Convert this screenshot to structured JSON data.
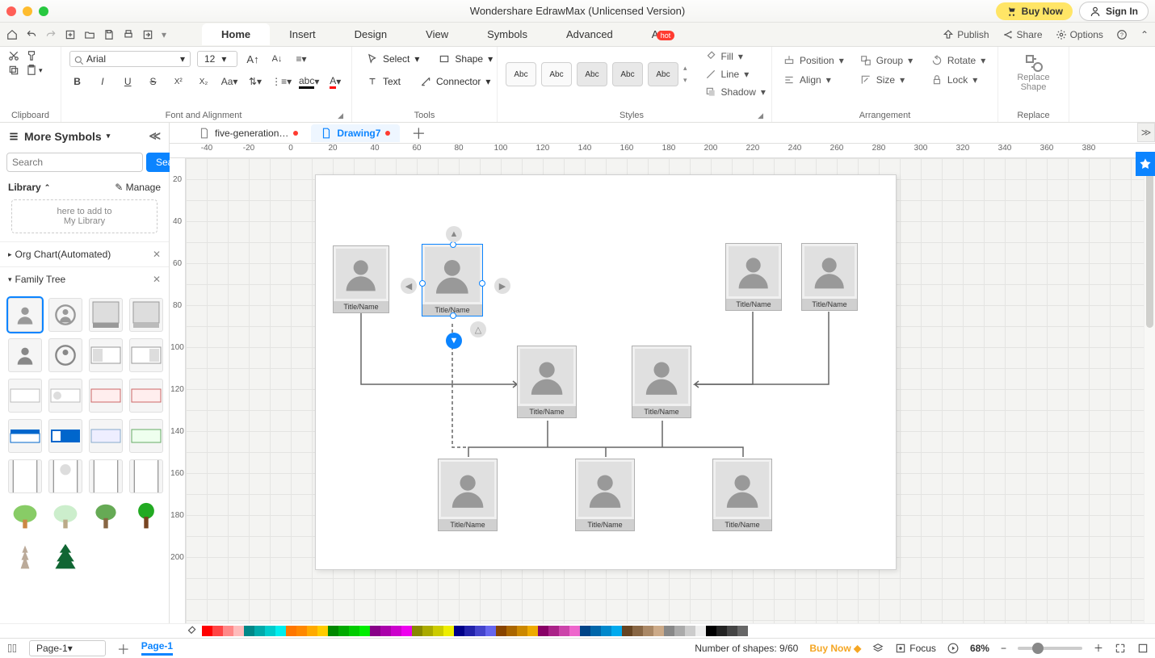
{
  "titlebar": {
    "title": "Wondershare EdrawMax (Unlicensed Version)",
    "buy": "Buy Now",
    "signin": "Sign In"
  },
  "menubar": {
    "tabs": [
      "Home",
      "Insert",
      "Design",
      "View",
      "Symbols",
      "Advanced",
      "AI"
    ],
    "active": 0,
    "hot": "hot",
    "right": {
      "publish": "Publish",
      "share": "Share",
      "options": "Options"
    }
  },
  "ribbon": {
    "font": {
      "name": "Arial",
      "size": "12"
    },
    "groups": {
      "clipboard": "Clipboard",
      "font": "Font and Alignment",
      "tools": "Tools",
      "styles": "Styles",
      "arrange": "Arrangement",
      "replace": "Replace"
    },
    "tools": {
      "select": "Select",
      "shape": "Shape",
      "text": "Text",
      "connector": "Connector"
    },
    "style_label": "Abc",
    "fill": "Fill",
    "line": "Line",
    "shadow": "Shadow",
    "position": "Position",
    "group": "Group",
    "rotate": "Rotate",
    "align": "Align",
    "size": "Size",
    "lock": "Lock",
    "replace_shape": "Replace\nShape"
  },
  "sidebar": {
    "title": "More Symbols",
    "search_placeholder": "Search",
    "search_btn": "Search",
    "library": "Library",
    "manage": "Manage",
    "drop_hint": "here to add to\nMy Library",
    "sections": [
      "Org Chart(Automated)",
      "Family Tree"
    ]
  },
  "filetabs": [
    {
      "label": "five-generation…",
      "active": false,
      "dirty": true
    },
    {
      "label": "Drawing7",
      "active": true,
      "dirty": true
    }
  ],
  "ruler_h": [
    "-40",
    "-20",
    "0",
    "20",
    "40",
    "60",
    "80",
    "100",
    "120",
    "140",
    "160",
    "180",
    "200",
    "220",
    "240",
    "260",
    "280",
    "300",
    "320",
    "340",
    "360",
    "380"
  ],
  "ruler_v": [
    "20",
    "40",
    "60",
    "80",
    "100",
    "120",
    "140",
    "160",
    "180",
    "200"
  ],
  "card_label": "Title/Name",
  "statusbar": {
    "page": "Page-1",
    "page_name": "Page-1",
    "shapes": "Number of shapes: 9/60",
    "buy": "Buy Now",
    "focus": "Focus",
    "zoom": "68%"
  },
  "colors": [
    "#f00",
    "#f44",
    "#f88",
    "#fbb",
    "#088",
    "#0aa",
    "#0cc",
    "#0ee",
    "#f70",
    "#f80",
    "#fa0",
    "#fc0",
    "#080",
    "#0a0",
    "#0c0",
    "#0e0",
    "#808",
    "#a0a",
    "#c0c",
    "#e0e",
    "#880",
    "#aa0",
    "#cc0",
    "#ee0",
    "#008",
    "#22a",
    "#44c",
    "#66e",
    "#840",
    "#a60",
    "#c80",
    "#ea0",
    "#806",
    "#a28",
    "#c4a",
    "#e6c",
    "#048",
    "#06a",
    "#08c",
    "#0ae",
    "#642",
    "#864",
    "#a86",
    "#ca8",
    "#888",
    "#aaa",
    "#ccc",
    "#eee",
    "#000",
    "#222",
    "#444",
    "#666"
  ]
}
